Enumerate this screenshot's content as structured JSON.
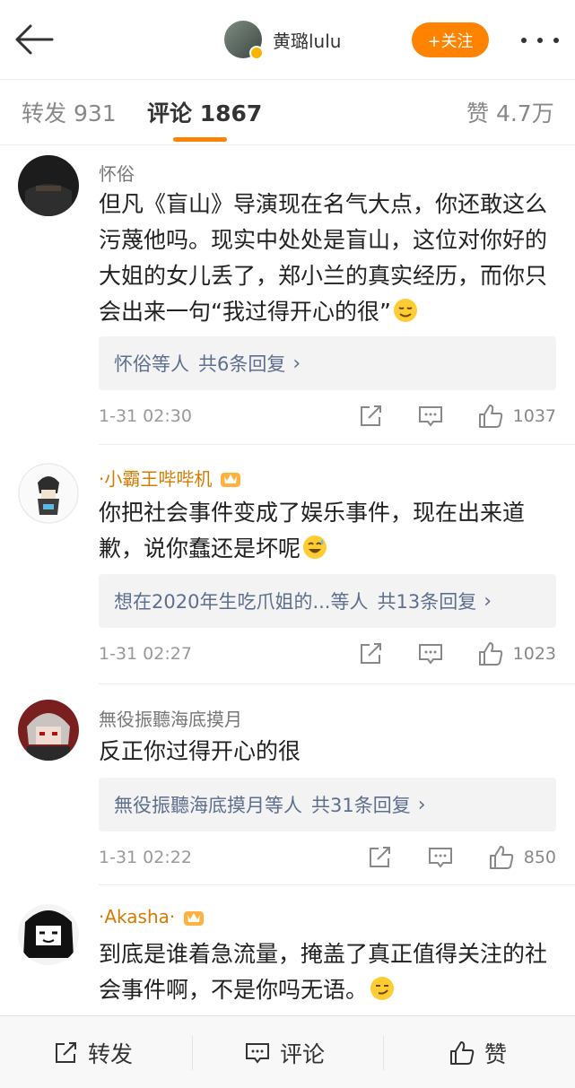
{
  "header": {
    "username": "黄璐lulu",
    "follow_label": "+关注"
  },
  "tabs": {
    "repost": "转发 931",
    "comment": "评论 1867",
    "like": "赞 4.7万"
  },
  "comments": [
    {
      "name": "怀俗",
      "text": "但凡《盲山》导演现在名气大点，你还敢这么污蔑他吗。现实中处处是盲山，这位对你好的大姐的女儿丢了，郑小兰的真实经历，而你只会出来一句“我过得开心的很”",
      "reply_users": "怀俗等人",
      "reply_count": "共6条回复",
      "time": "1-31 02:30",
      "likes": "1037"
    },
    {
      "name": "·小霸王哔哔机",
      "text": "你把社会事件变成了娱乐事件，现在出来道歉，说你蠢还是坏呢",
      "reply_users": "想在2020年生吃爪姐的...等人",
      "reply_count": "共13条回复",
      "time": "1-31 02:27",
      "likes": "1023"
    },
    {
      "name": "無役振聽海底摸月",
      "text": "反正你过得开心的很",
      "reply_users": "無役振聽海底摸月等人",
      "reply_count": "共31条回复",
      "time": "1-31 02:22",
      "likes": "850"
    },
    {
      "name": "·Akasha·",
      "text": "到底是谁着急流量，掩盖了真正值得关注的社会事件啊，不是你吗无语。"
    }
  ],
  "bottombar": {
    "repost": "转发",
    "comment": "评论",
    "like": "赞"
  },
  "colors": {
    "accent": "#ff8200",
    "link": "#5d6f8f",
    "vip_name": "#d47b00"
  }
}
